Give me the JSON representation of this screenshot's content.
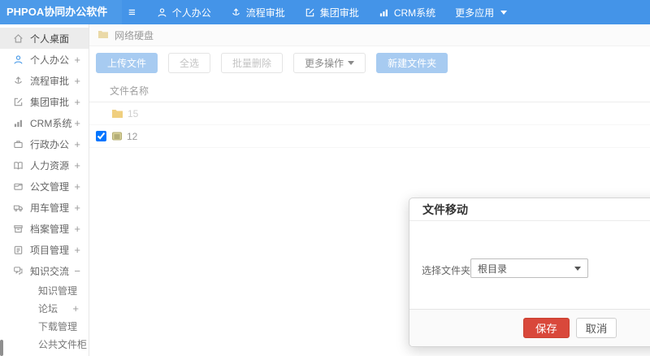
{
  "topbar": {
    "logo": "PHPOA协同办公软件",
    "hamburger": "≡",
    "nav": [
      {
        "label": "个人办公",
        "icon": "user-icon"
      },
      {
        "label": "流程审批",
        "icon": "process-icon"
      },
      {
        "label": "集团审批",
        "icon": "edit-icon"
      },
      {
        "label": "CRM系统",
        "icon": "chart-icon"
      },
      {
        "label": "更多应用",
        "icon": "caret-down-icon"
      }
    ]
  },
  "sidebar": {
    "items": [
      {
        "label": "个人桌面",
        "expand": "",
        "icon": "home-icon",
        "active": true
      },
      {
        "label": "个人办公",
        "expand": "+",
        "icon": "user-icon"
      },
      {
        "label": "流程审批",
        "expand": "+",
        "icon": "process-icon"
      },
      {
        "label": "集团审批",
        "expand": "+",
        "icon": "edit-icon"
      },
      {
        "label": "CRM系统",
        "expand": "+",
        "icon": "chart-icon"
      },
      {
        "label": "行政办公",
        "expand": "+",
        "icon": "briefcase-icon"
      },
      {
        "label": "人力资源",
        "expand": "+",
        "icon": "book-icon"
      },
      {
        "label": "公文管理",
        "expand": "+",
        "icon": "document-icon"
      },
      {
        "label": "用车管理",
        "expand": "+",
        "icon": "truck-icon"
      },
      {
        "label": "档案管理",
        "expand": "+",
        "icon": "archive-icon"
      },
      {
        "label": "项目管理",
        "expand": "+",
        "icon": "clipboard-icon"
      },
      {
        "label": "知识交流",
        "expand": "−",
        "icon": "chat-icon",
        "expanded": true
      }
    ],
    "subitems": [
      {
        "label": "知识管理",
        "expand": ""
      },
      {
        "label": "论坛",
        "expand": "+"
      },
      {
        "label": "下载管理",
        "expand": ""
      },
      {
        "label": "公共文件柜",
        "expand": ""
      }
    ]
  },
  "breadcrumb": {
    "label": "网络硬盘",
    "icon": "folder-icon"
  },
  "toolbar": {
    "upload": "上传文件",
    "select_all": "全选",
    "batch_delete": "批量删除",
    "more_ops": "更多操作",
    "new_folder": "新建文件夹"
  },
  "filetable": {
    "name_header": "文件名称",
    "rows": [
      {
        "name": "15",
        "type": "folder",
        "checked": false
      },
      {
        "name": "12",
        "type": "file",
        "checked": true
      }
    ]
  },
  "modal": {
    "title": "文件移动",
    "folder_label": "选择文件夹",
    "selected_folder": "根目录",
    "save_label": "保存",
    "cancel_label": "取消"
  },
  "colors": {
    "topbar_blue": "#4494e8",
    "logo_blue": "#4c9ae9",
    "active_item_bg": "#ececec",
    "primary_light_button": "#a7cbf1",
    "save_red": "#d9483b",
    "folder_yellow": "#f0cf7e"
  }
}
